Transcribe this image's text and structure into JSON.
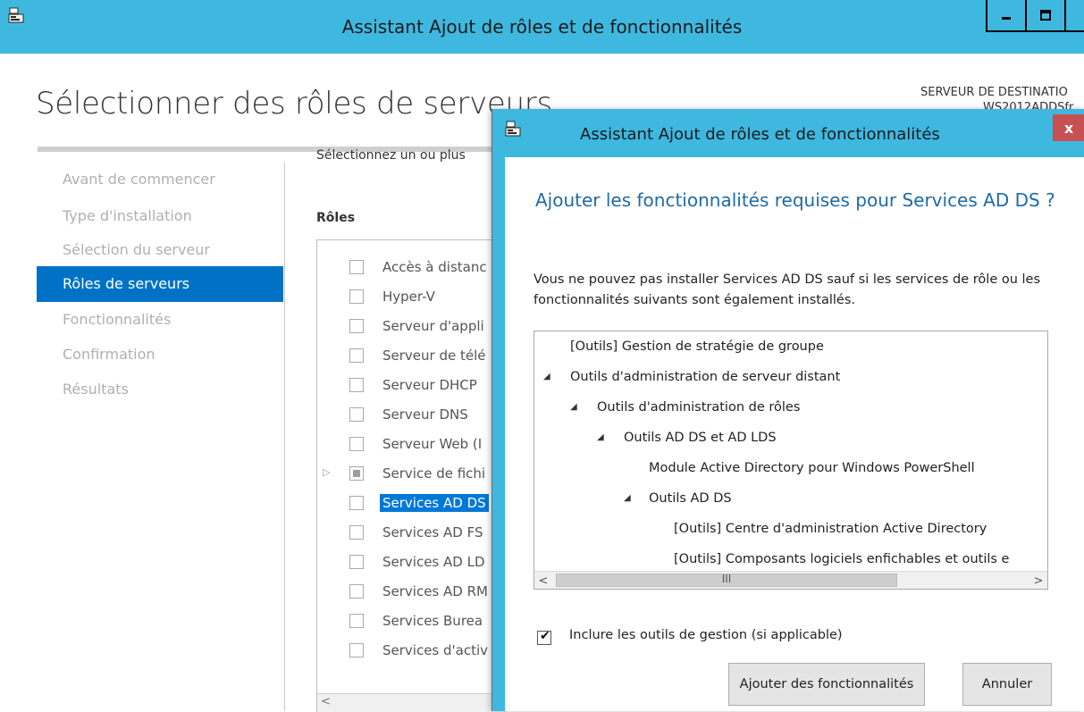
{
  "window": {
    "title": "Assistant Ajout de rôles et de fonctionnalités",
    "page_title": "Sélectionner des rôles de serveurs",
    "destination_label": "SERVEUR DE DESTINATIO",
    "destination_server": "WS2012ADDSfr"
  },
  "nav": {
    "items": [
      {
        "label": "Avant de commencer",
        "active": false
      },
      {
        "label": "Type d'installation",
        "active": false
      },
      {
        "label": "Sélection du serveur",
        "active": false
      },
      {
        "label": "Rôles de serveurs",
        "active": true
      },
      {
        "label": "Fonctionnalités",
        "active": false
      },
      {
        "label": "Confirmation",
        "active": false
      },
      {
        "label": "Résultats",
        "active": false
      }
    ]
  },
  "roles_panel": {
    "instruction": "Sélectionnez un ou plus",
    "header": "Rôles",
    "items": [
      {
        "label": "Accès à distanc"
      },
      {
        "label": "Hyper-V"
      },
      {
        "label": "Serveur d'appli"
      },
      {
        "label": "Serveur de télé"
      },
      {
        "label": "Serveur DHCP"
      },
      {
        "label": "Serveur DNS"
      },
      {
        "label": "Serveur Web (I"
      },
      {
        "label": "Service de fichi"
      },
      {
        "label": "Services AD DS"
      },
      {
        "label": "Services AD FS"
      },
      {
        "label": "Services AD LD"
      },
      {
        "label": "Services AD RM"
      },
      {
        "label": "Services Burea"
      },
      {
        "label": "Services d'activ"
      }
    ]
  },
  "dialog": {
    "title": "Assistant Ajout de rôles et de fonctionnalités",
    "heading": "Ajouter les fonctionnalités requises pour Services AD DS ?",
    "description": "Vous ne pouvez pas installer Services AD DS sauf si les services de rôle ou les fonctionnalités suivants sont également installés.",
    "features": [
      {
        "label": "[Outils] Gestion de stratégie de groupe",
        "expander": ""
      },
      {
        "label": "Outils d'administration de serveur distant",
        "expander": "◢"
      },
      {
        "label": "Outils d'administration de rôles",
        "expander": "◢"
      },
      {
        "label": "Outils AD DS et AD LDS",
        "expander": "◢"
      },
      {
        "label": "Module Active Directory pour Windows PowerShell",
        "expander": ""
      },
      {
        "label": "Outils AD DS",
        "expander": "◢"
      },
      {
        "label": "[Outils] Centre d'administration Active Directory",
        "expander": ""
      },
      {
        "label": "[Outils] Composants logiciels enfichables et outils e",
        "expander": ""
      }
    ],
    "scroll_left": "<",
    "scroll_right": ">",
    "scroll_grip": "III",
    "include_tools_label": "Inclure les outils de gestion (si applicable)",
    "include_tools_checked": true,
    "add_button": "Ajouter des fonctionnalités",
    "cancel_button": "Annuler",
    "close_glyph": "x"
  },
  "colors": {
    "titlebar": "#3fb8e0",
    "nav_active": "#0072c6",
    "selection": "#0078d7",
    "dialog_heading": "#1f6aa8",
    "close_button": "#c75050"
  }
}
